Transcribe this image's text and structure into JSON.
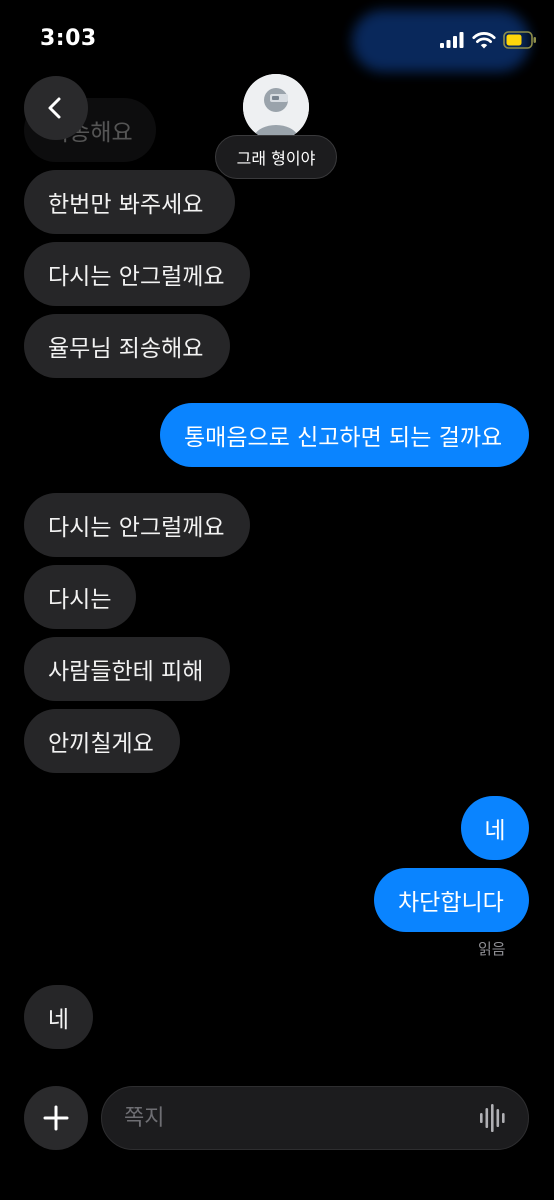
{
  "status": {
    "time": "3:03"
  },
  "header": {
    "name": "그래 형이야"
  },
  "messages": [
    {
      "side": "in",
      "text": "죄송해요"
    },
    {
      "side": "in",
      "text": "한번만  봐주세요"
    },
    {
      "side": "in",
      "text": "다시는 안그럴께요"
    },
    {
      "side": "in",
      "text": "율무님 죄송해요"
    },
    {
      "side": "out",
      "text": "통매음으로 신고하면 되는 걸까요"
    },
    {
      "side": "in",
      "text": "다시는 안그럴께요"
    },
    {
      "side": "in",
      "text": "다시는"
    },
    {
      "side": "in",
      "text": "사람들한테 피해"
    },
    {
      "side": "in",
      "text": "안끼칠게요"
    },
    {
      "side": "out",
      "text": "네"
    },
    {
      "side": "out",
      "text": "차단합니다"
    },
    {
      "side": "in",
      "text": "네"
    }
  ],
  "read_receipt": "읽음",
  "composer": {
    "placeholder": "쪽지"
  },
  "colors": {
    "incoming_bubble": "#262628",
    "outgoing_bubble": "#0a84ff",
    "battery": "#ffd60a"
  }
}
